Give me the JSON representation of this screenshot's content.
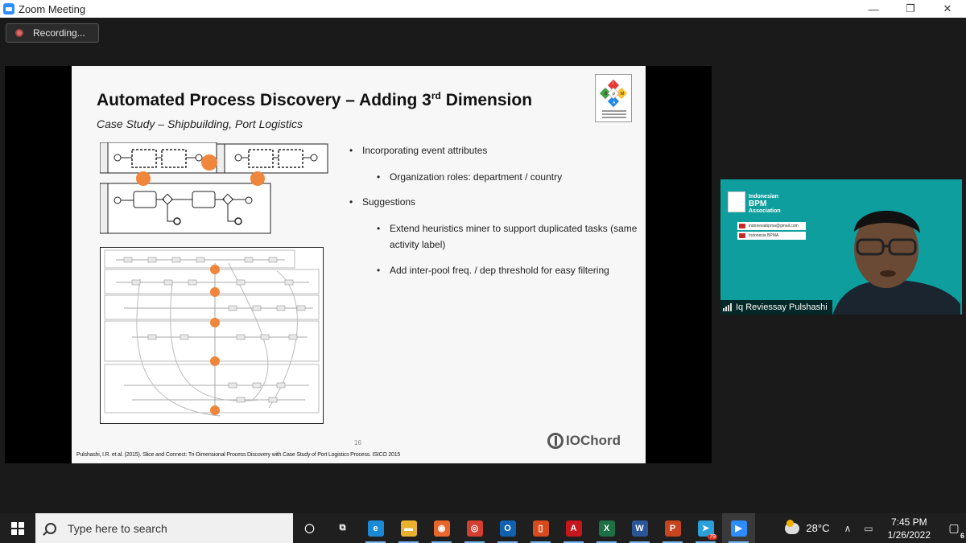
{
  "window": {
    "title": "Zoom Meeting",
    "minimize_glyph": "—",
    "restore_glyph": "❐",
    "close_glyph": "✕"
  },
  "recording": {
    "label": "Recording..."
  },
  "slide": {
    "title_main": "Automated Process Discovery – Adding 3",
    "title_sup": "rd",
    "title_end": " Dimension",
    "subtitle": "Case Study – Shipbuilding, Port Logistics",
    "bullets": [
      {
        "text": "Incorporating event attributes",
        "sub": [
          "Organization roles: department / country"
        ]
      },
      {
        "text": "Suggestions",
        "sub": [
          "Extend heuristics miner to support duplicated tasks (same activity label)",
          "Add inter-pool freq. / dep threshold for easy filtering"
        ]
      }
    ],
    "page_number": "16",
    "brand": "IOChord",
    "citation": "Pulshashi, I.R. et al. (2015). Slice and Connect: Tri-Dimensional Process Discovery with Case Study of Port Logistics Process. ISICO 2015",
    "logo_letters": [
      "I",
      "B",
      "P",
      "M",
      "A"
    ]
  },
  "video": {
    "participant_name": "Iq Reviessay Pulshashi",
    "banner": {
      "line1": "Indonesian",
      "line2": "BPM",
      "line3": "Association",
      "email": "indonesiabpma@gmail.com",
      "youtube": "Indonesia BPMA"
    }
  },
  "taskbar": {
    "search_placeholder": "Type here to search",
    "apps": [
      {
        "name": "cortana",
        "glyph": "◯",
        "color": "transparent"
      },
      {
        "name": "task-view",
        "glyph": "⧉",
        "color": "transparent"
      },
      {
        "name": "edge",
        "glyph": "e",
        "color": "#1b8ad6"
      },
      {
        "name": "file-explorer",
        "glyph": "▬",
        "color": "#e8b22e"
      },
      {
        "name": "firefox",
        "glyph": "◉",
        "color": "#e8662a"
      },
      {
        "name": "chrome",
        "glyph": "◎",
        "color": "#d23f31"
      },
      {
        "name": "outlook",
        "glyph": "O",
        "color": "#1062b0"
      },
      {
        "name": "office",
        "glyph": "▯",
        "color": "#d64a1e"
      },
      {
        "name": "acrobat",
        "glyph": "A",
        "color": "#c4161c"
      },
      {
        "name": "excel",
        "glyph": "X",
        "color": "#1d7044"
      },
      {
        "name": "word",
        "glyph": "W",
        "color": "#2a5699"
      },
      {
        "name": "powerpoint",
        "glyph": "P",
        "color": "#c6441e"
      },
      {
        "name": "telegram",
        "glyph": "➤",
        "color": "#2a9fd8",
        "badge": "79"
      },
      {
        "name": "zoom",
        "glyph": "▶",
        "color": "#2d8cff"
      }
    ],
    "temperature": "28°C",
    "time": "7:45 PM",
    "date": "1/26/2022",
    "notification_count": "6",
    "caret": "∧"
  }
}
